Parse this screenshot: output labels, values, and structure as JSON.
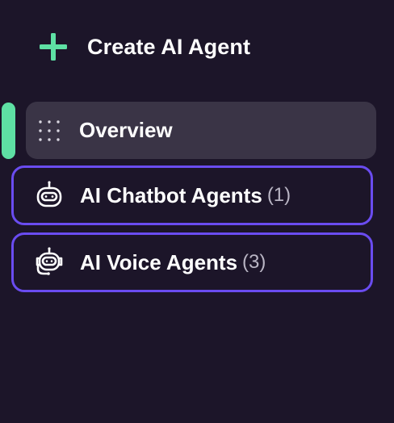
{
  "colors": {
    "background": "#1c1529",
    "accent_green": "#5ee0a4",
    "selected_bg": "#3a3446",
    "outline_purple": "#6a4cf0"
  },
  "create_button": {
    "label": "Create AI Agent",
    "icon": "plus-icon"
  },
  "nav": {
    "overview": {
      "label": "Overview",
      "icon": "grid-dots-icon"
    },
    "chatbot_agents": {
      "label": "AI Chatbot Agents",
      "count": "(1)",
      "icon": "robot-head-icon"
    },
    "voice_agents": {
      "label": "AI Voice Agents",
      "count": "(3)",
      "icon": "robot-headset-icon"
    }
  }
}
